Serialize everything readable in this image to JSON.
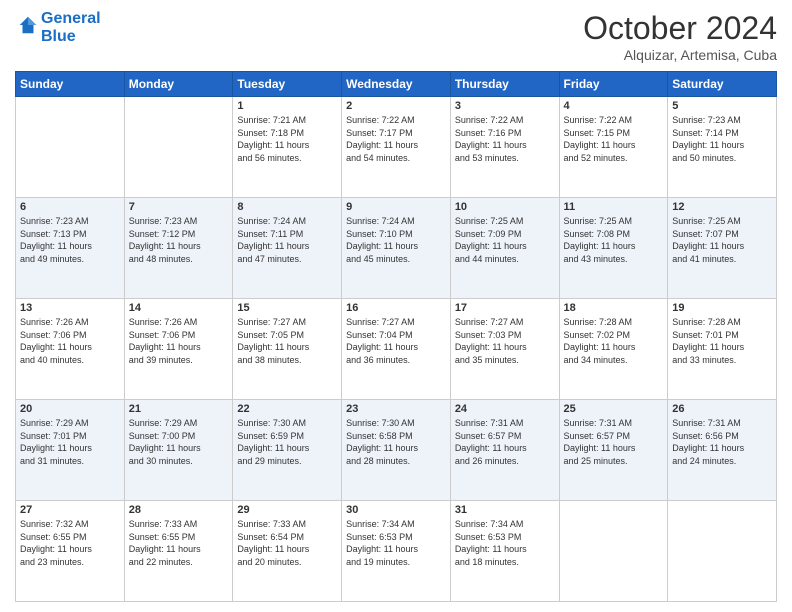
{
  "header": {
    "logo_line1": "General",
    "logo_line2": "Blue",
    "month": "October 2024",
    "location": "Alquizar, Artemisa, Cuba"
  },
  "weekdays": [
    "Sunday",
    "Monday",
    "Tuesday",
    "Wednesday",
    "Thursday",
    "Friday",
    "Saturday"
  ],
  "weeks": [
    [
      {
        "day": "",
        "info": ""
      },
      {
        "day": "",
        "info": ""
      },
      {
        "day": "1",
        "info": "Sunrise: 7:21 AM\nSunset: 7:18 PM\nDaylight: 11 hours\nand 56 minutes."
      },
      {
        "day": "2",
        "info": "Sunrise: 7:22 AM\nSunset: 7:17 PM\nDaylight: 11 hours\nand 54 minutes."
      },
      {
        "day": "3",
        "info": "Sunrise: 7:22 AM\nSunset: 7:16 PM\nDaylight: 11 hours\nand 53 minutes."
      },
      {
        "day": "4",
        "info": "Sunrise: 7:22 AM\nSunset: 7:15 PM\nDaylight: 11 hours\nand 52 minutes."
      },
      {
        "day": "5",
        "info": "Sunrise: 7:23 AM\nSunset: 7:14 PM\nDaylight: 11 hours\nand 50 minutes."
      }
    ],
    [
      {
        "day": "6",
        "info": "Sunrise: 7:23 AM\nSunset: 7:13 PM\nDaylight: 11 hours\nand 49 minutes."
      },
      {
        "day": "7",
        "info": "Sunrise: 7:23 AM\nSunset: 7:12 PM\nDaylight: 11 hours\nand 48 minutes."
      },
      {
        "day": "8",
        "info": "Sunrise: 7:24 AM\nSunset: 7:11 PM\nDaylight: 11 hours\nand 47 minutes."
      },
      {
        "day": "9",
        "info": "Sunrise: 7:24 AM\nSunset: 7:10 PM\nDaylight: 11 hours\nand 45 minutes."
      },
      {
        "day": "10",
        "info": "Sunrise: 7:25 AM\nSunset: 7:09 PM\nDaylight: 11 hours\nand 44 minutes."
      },
      {
        "day": "11",
        "info": "Sunrise: 7:25 AM\nSunset: 7:08 PM\nDaylight: 11 hours\nand 43 minutes."
      },
      {
        "day": "12",
        "info": "Sunrise: 7:25 AM\nSunset: 7:07 PM\nDaylight: 11 hours\nand 41 minutes."
      }
    ],
    [
      {
        "day": "13",
        "info": "Sunrise: 7:26 AM\nSunset: 7:06 PM\nDaylight: 11 hours\nand 40 minutes."
      },
      {
        "day": "14",
        "info": "Sunrise: 7:26 AM\nSunset: 7:06 PM\nDaylight: 11 hours\nand 39 minutes."
      },
      {
        "day": "15",
        "info": "Sunrise: 7:27 AM\nSunset: 7:05 PM\nDaylight: 11 hours\nand 38 minutes."
      },
      {
        "day": "16",
        "info": "Sunrise: 7:27 AM\nSunset: 7:04 PM\nDaylight: 11 hours\nand 36 minutes."
      },
      {
        "day": "17",
        "info": "Sunrise: 7:27 AM\nSunset: 7:03 PM\nDaylight: 11 hours\nand 35 minutes."
      },
      {
        "day": "18",
        "info": "Sunrise: 7:28 AM\nSunset: 7:02 PM\nDaylight: 11 hours\nand 34 minutes."
      },
      {
        "day": "19",
        "info": "Sunrise: 7:28 AM\nSunset: 7:01 PM\nDaylight: 11 hours\nand 33 minutes."
      }
    ],
    [
      {
        "day": "20",
        "info": "Sunrise: 7:29 AM\nSunset: 7:01 PM\nDaylight: 11 hours\nand 31 minutes."
      },
      {
        "day": "21",
        "info": "Sunrise: 7:29 AM\nSunset: 7:00 PM\nDaylight: 11 hours\nand 30 minutes."
      },
      {
        "day": "22",
        "info": "Sunrise: 7:30 AM\nSunset: 6:59 PM\nDaylight: 11 hours\nand 29 minutes."
      },
      {
        "day": "23",
        "info": "Sunrise: 7:30 AM\nSunset: 6:58 PM\nDaylight: 11 hours\nand 28 minutes."
      },
      {
        "day": "24",
        "info": "Sunrise: 7:31 AM\nSunset: 6:57 PM\nDaylight: 11 hours\nand 26 minutes."
      },
      {
        "day": "25",
        "info": "Sunrise: 7:31 AM\nSunset: 6:57 PM\nDaylight: 11 hours\nand 25 minutes."
      },
      {
        "day": "26",
        "info": "Sunrise: 7:31 AM\nSunset: 6:56 PM\nDaylight: 11 hours\nand 24 minutes."
      }
    ],
    [
      {
        "day": "27",
        "info": "Sunrise: 7:32 AM\nSunset: 6:55 PM\nDaylight: 11 hours\nand 23 minutes."
      },
      {
        "day": "28",
        "info": "Sunrise: 7:33 AM\nSunset: 6:55 PM\nDaylight: 11 hours\nand 22 minutes."
      },
      {
        "day": "29",
        "info": "Sunrise: 7:33 AM\nSunset: 6:54 PM\nDaylight: 11 hours\nand 20 minutes."
      },
      {
        "day": "30",
        "info": "Sunrise: 7:34 AM\nSunset: 6:53 PM\nDaylight: 11 hours\nand 19 minutes."
      },
      {
        "day": "31",
        "info": "Sunrise: 7:34 AM\nSunset: 6:53 PM\nDaylight: 11 hours\nand 18 minutes."
      },
      {
        "day": "",
        "info": ""
      },
      {
        "day": "",
        "info": ""
      }
    ]
  ]
}
